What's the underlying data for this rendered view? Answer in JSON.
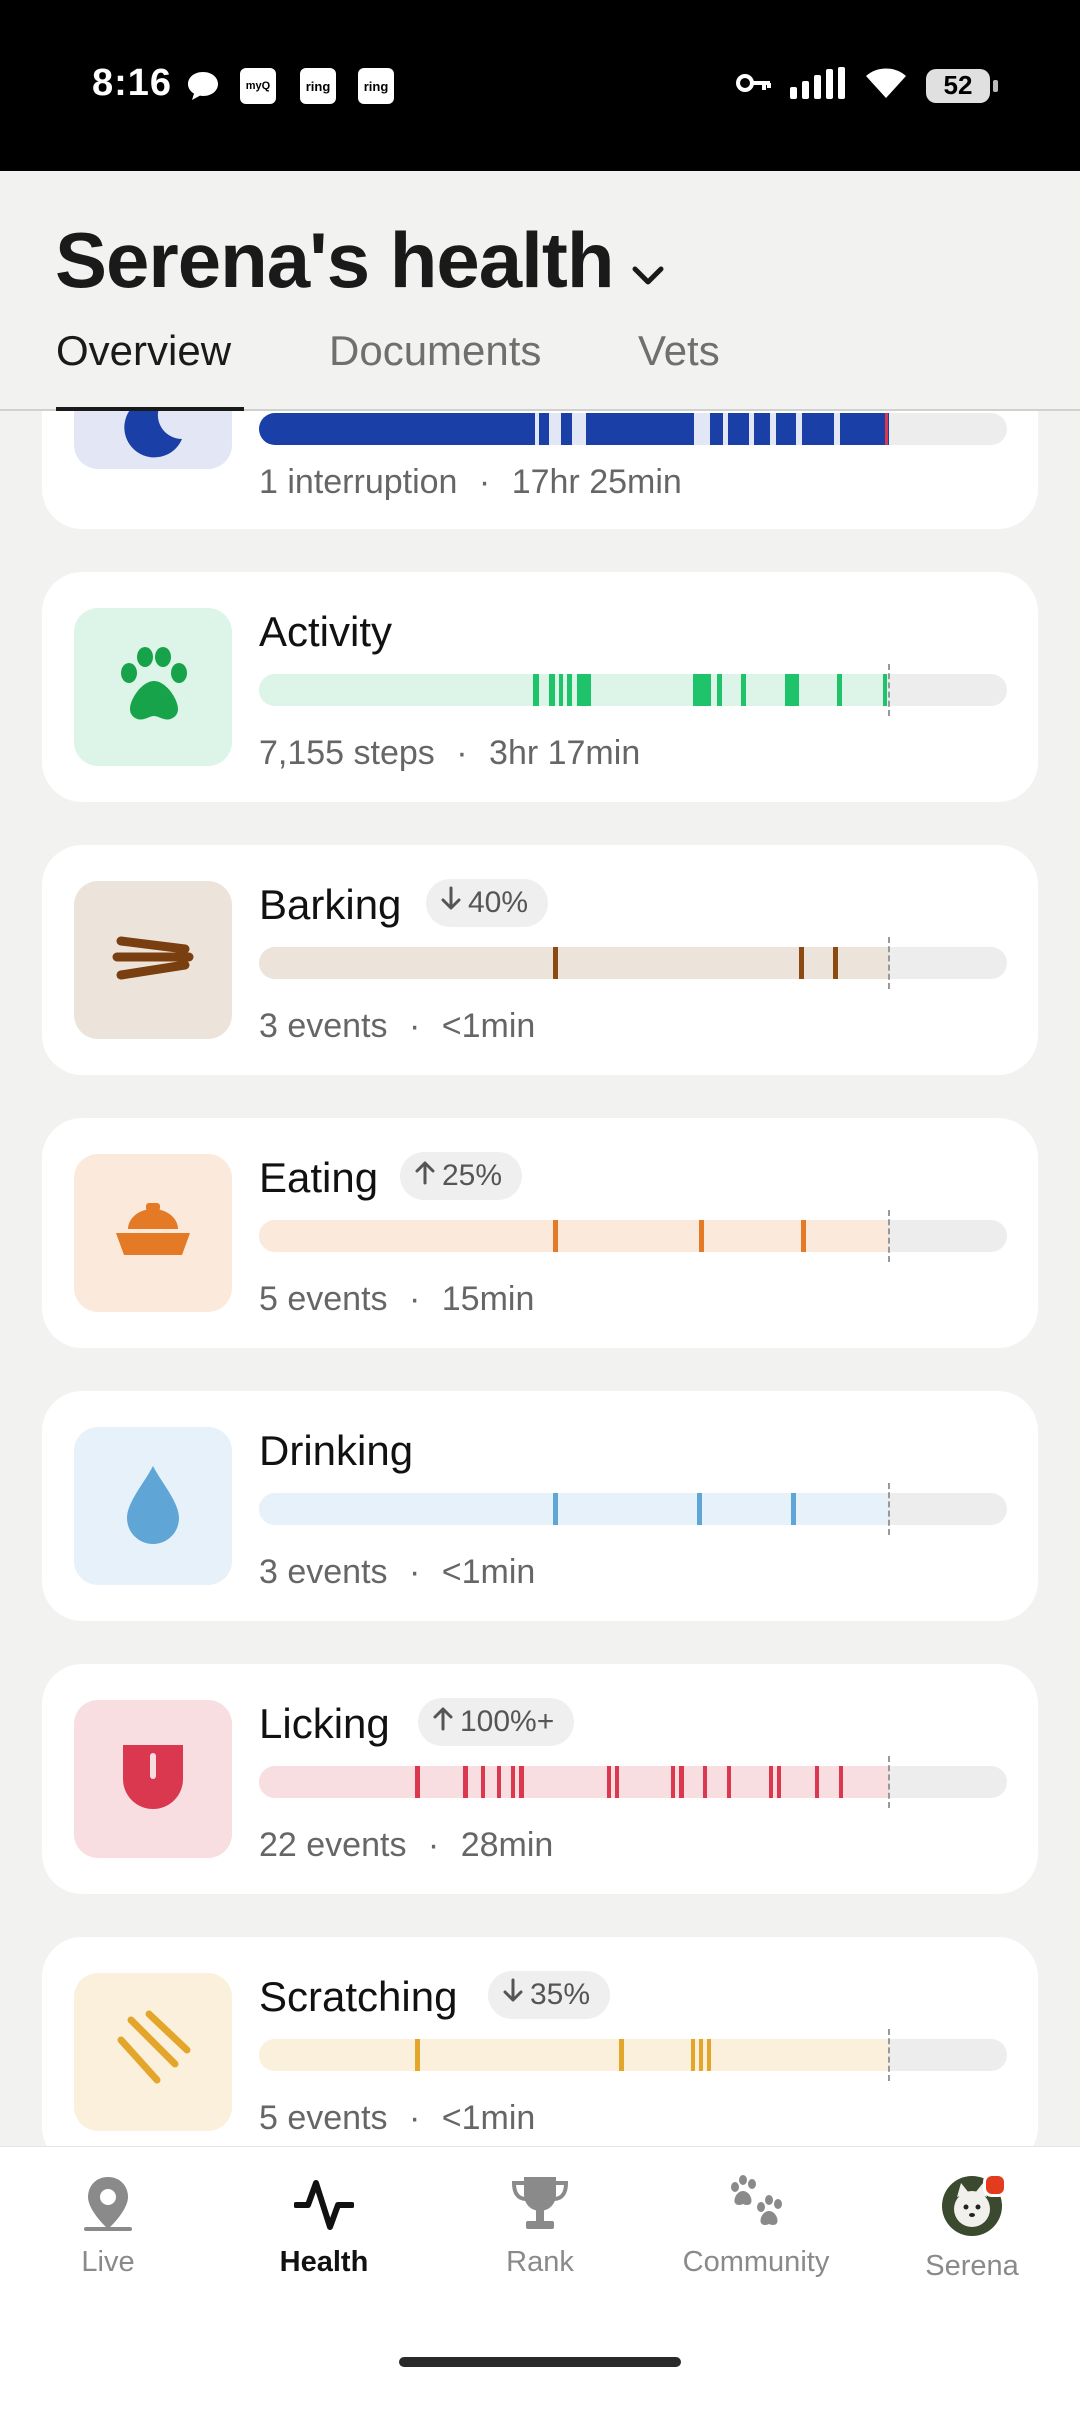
{
  "status": {
    "time": "8:16",
    "battery": "52",
    "notif_icons": [
      "chat-bubble-icon",
      "myq-icon",
      "ring-icon",
      "ring-icon"
    ],
    "notif_labels": [
      "",
      "myQ",
      "ring",
      "ring"
    ]
  },
  "header": {
    "title": "Serena's health",
    "tabs": [
      "Overview",
      "Documents",
      "Vets"
    ],
    "active_tab": "Overview"
  },
  "cards": [
    {
      "id": "sleep",
      "name": "",
      "summary_count": "1 interruption",
      "summary_duration": "17hr 25min",
      "accent": "#1a3fa6",
      "tint": "#e3e6f5",
      "icon": "moon-icon"
    },
    {
      "id": "activity",
      "name": "Activity",
      "summary_count": "7,155 steps",
      "summary_duration": "3hr 17min",
      "accent": "#1fc46a",
      "tint": "#dcf5e8",
      "icon": "paw-icon"
    },
    {
      "id": "barking",
      "name": "Barking",
      "badge": "40%",
      "badge_dir": "down",
      "summary_count": "3 events",
      "summary_duration": "<1min",
      "accent": "#8a4a12",
      "tint": "#ece4da",
      "icon": "bark-lines-icon"
    },
    {
      "id": "eating",
      "name": "Eating",
      "badge": "25%",
      "badge_dir": "up",
      "summary_count": "5 events",
      "summary_duration": "15min",
      "accent": "#e47a26",
      "tint": "#fbe9dc",
      "icon": "food-bowl-icon"
    },
    {
      "id": "drinking",
      "name": "Drinking",
      "summary_count": "3 events",
      "summary_duration": "<1min",
      "accent": "#5fa6d6",
      "tint": "#e6f1fa",
      "icon": "water-drop-icon"
    },
    {
      "id": "licking",
      "name": "Licking",
      "badge": "100%+",
      "badge_dir": "up",
      "summary_count": "22 events",
      "summary_duration": "28min",
      "accent": "#d9384f",
      "tint": "#f8dde1",
      "icon": "tongue-icon"
    },
    {
      "id": "scratching",
      "name": "Scratching",
      "badge": "35%",
      "badge_dir": "down",
      "summary_count": "5 events",
      "summary_duration": "<1min",
      "accent": "#e3a62a",
      "tint": "#faf0dc",
      "icon": "scratch-lines-icon"
    }
  ],
  "nav": {
    "items": [
      "Live",
      "Health",
      "Rank",
      "Community",
      "Serena"
    ],
    "active": "Health"
  },
  "separator": "·"
}
